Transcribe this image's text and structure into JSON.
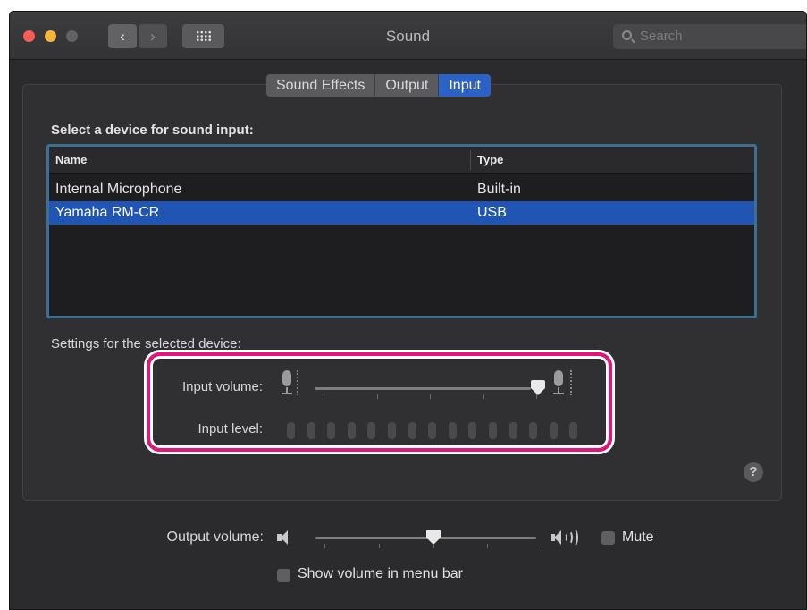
{
  "window": {
    "title": "Sound",
    "search_placeholder": "Search"
  },
  "tabs": [
    {
      "label": "Sound Effects",
      "active": false
    },
    {
      "label": "Output",
      "active": false
    },
    {
      "label": "Input",
      "active": true
    }
  ],
  "input_devices": {
    "section_label": "Select a device for sound input:",
    "columns": [
      "Name",
      "Type"
    ],
    "rows": [
      {
        "name": "Internal Microphone",
        "type": "Built-in",
        "selected": false
      },
      {
        "name": "Yamaha RM-CR",
        "type": "USB",
        "selected": true
      }
    ]
  },
  "settings": {
    "label": "Settings for the selected device:",
    "input_volume_label": "Input volume:",
    "input_volume_value": 1.0,
    "input_level_label": "Input level:",
    "input_level_segments": 15,
    "input_level_active": 0
  },
  "output": {
    "volume_label": "Output volume:",
    "volume_value": 0.5,
    "mute_label": "Mute",
    "mute_checked": false,
    "show_volume_label": "Show volume in menu bar",
    "show_volume_checked": false
  },
  "help_label": "?",
  "colors": {
    "highlight": "#e3147c",
    "selection": "#2155b4",
    "active_tab": "#2c62c6"
  },
  "icons": [
    "back-chevron-icon",
    "forward-chevron-icon",
    "grid-icon",
    "search-icon",
    "mic-low-icon",
    "mic-high-icon",
    "speaker-low-icon",
    "speaker-high-icon",
    "help-icon"
  ]
}
